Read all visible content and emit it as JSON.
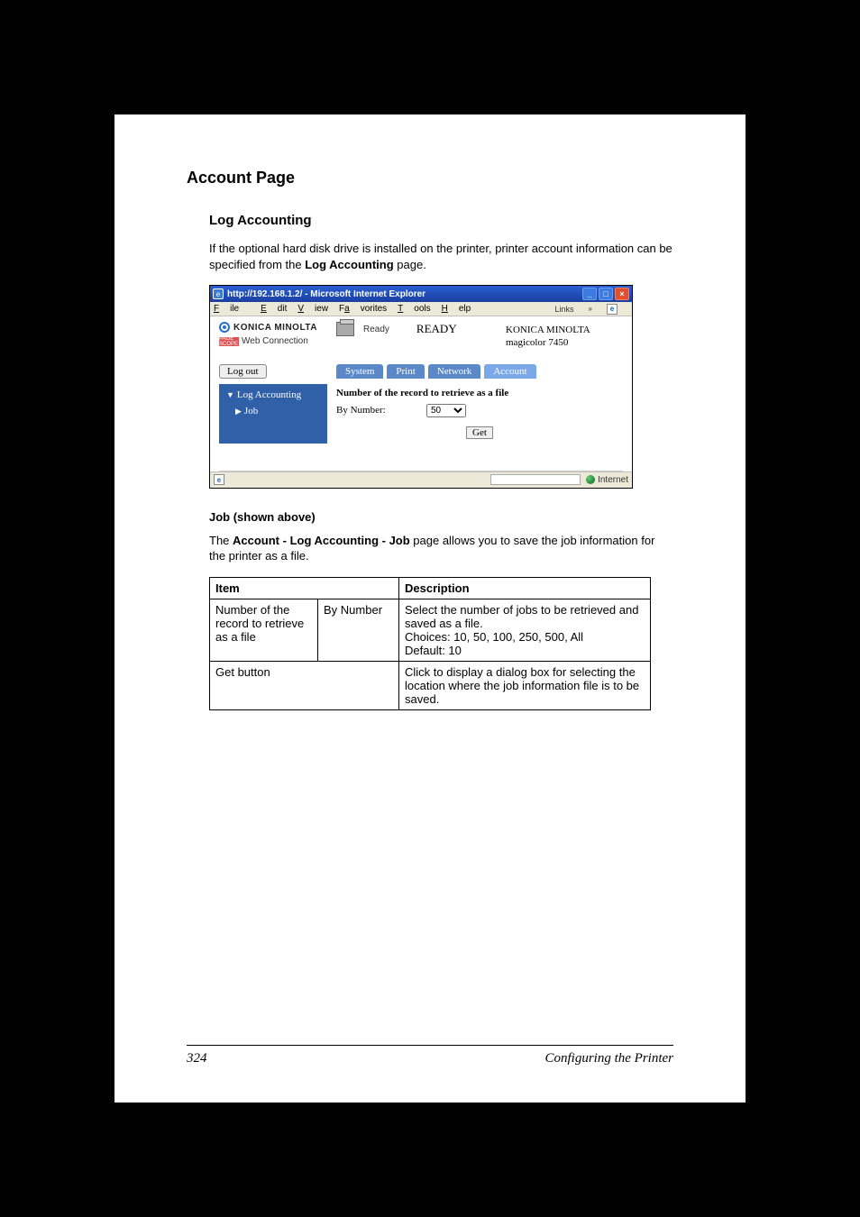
{
  "section_title": "Account Page",
  "subsection_title": "Log Accounting",
  "intro_1": "If the optional hard disk drive is installed on the printer, printer account information can be specified from the ",
  "intro_bold": "Log Accounting",
  "intro_2": " page.",
  "shot": {
    "window_title": "http://192.168.1.2/ - Microsoft Internet Explorer",
    "menu": {
      "file": "File",
      "edit": "Edit",
      "view": "View",
      "favorites": "Favorites",
      "tools": "Tools",
      "help": "Help"
    },
    "links_label": "Links",
    "brand": "KONICA MINOLTA",
    "pagescope_icon_text": "PAGE SCOPE",
    "pagescope": "Web Connection",
    "status_small": "Ready",
    "status_big": "READY",
    "model_line1": "KONICA MINOLTA",
    "model_line2": "magicolor 7450",
    "logout": "Log out",
    "tabs": {
      "system": "System",
      "print": "Print",
      "network": "Network",
      "account": "Account"
    },
    "side_header": "Log Accounting",
    "side_item": "Job",
    "main_title": "Number of the record to retrieve as a file",
    "by_number_label": "By Number:",
    "by_number_value": "50",
    "get_label": "Get",
    "statusbar_zone": "Internet"
  },
  "job_heading": "Job (shown above)",
  "job_desc_1": "The ",
  "job_desc_bold": "Account - Log Accounting - Job",
  "job_desc_2": " page allows you to save the job information for the printer as a file.",
  "table": {
    "h_item": "Item",
    "h_desc": "Description",
    "r1_c1": "Number of the record to retrieve as a file",
    "r1_c2": "By Number",
    "r1_c3_l1": "Select the number of jobs to be retrieved and saved as a file.",
    "r1_c3_l2": "Choices: 10, 50, 100, 250, 500, All",
    "r1_c3_l3": "Default:  10",
    "r2_c1": "Get button",
    "r2_c3": "Click to display a dialog box for selecting the location where the job information file is to be saved."
  },
  "footer_page": "324",
  "footer_title": "Configuring the Printer"
}
